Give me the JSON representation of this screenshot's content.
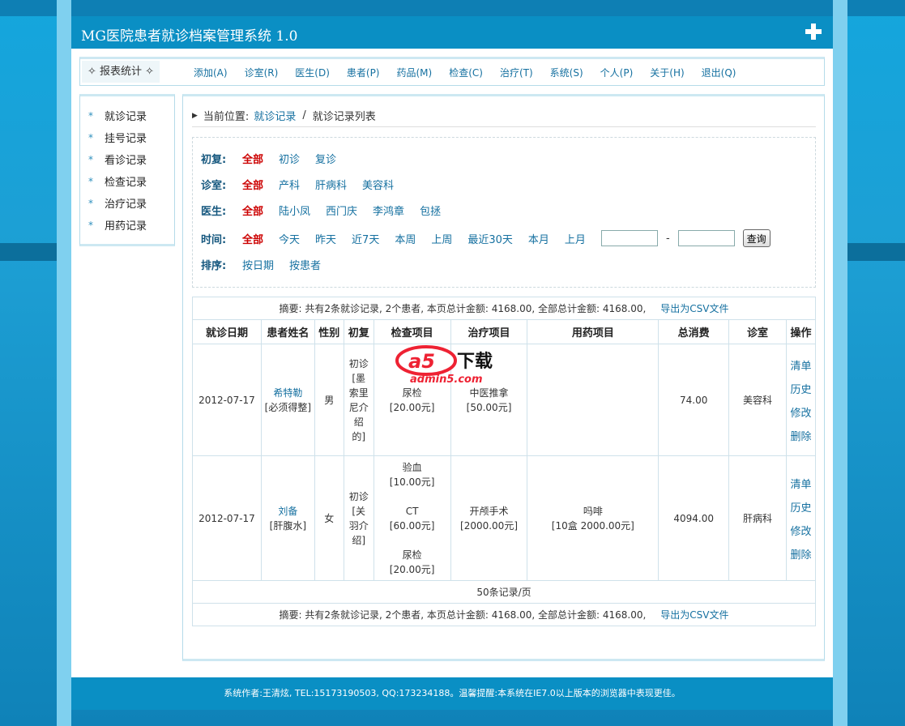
{
  "app": {
    "title": "MG医院患者就诊档案管理系统 1.0"
  },
  "menu": {
    "report_label": "✧ 报表统计 ✧",
    "items": [
      "添加(A)",
      "诊室(R)",
      "医生(D)",
      "患者(P)",
      "药品(M)",
      "检查(C)",
      "治疗(T)",
      "系统(S)",
      "个人(P)",
      "关于(H)",
      "退出(Q)"
    ]
  },
  "sidebar": {
    "items": [
      "就诊记录",
      "挂号记录",
      "看诊记录",
      "检查记录",
      "治疗记录",
      "用药记录"
    ]
  },
  "breadcrumb": {
    "prefix": "当前位置:",
    "link": "就诊记录",
    "sep": "/",
    "current": "就诊记录列表"
  },
  "filters": {
    "visit_type": {
      "label": "初复:",
      "options": [
        "全部",
        "初诊",
        "复诊"
      ]
    },
    "room": {
      "label": "诊室:",
      "options": [
        "全部",
        "产科",
        "肝病科",
        "美容科"
      ]
    },
    "doctor": {
      "label": "医生:",
      "options": [
        "全部",
        "陆小凤",
        "西门庆",
        "李鸿章",
        "包拯"
      ]
    },
    "time": {
      "label": "时间:",
      "options": [
        "全部",
        "今天",
        "昨天",
        "近7天",
        "本周",
        "上周",
        "最近30天",
        "本月",
        "上月"
      ],
      "from_value": "",
      "to_value": "",
      "dash": "-",
      "query_label": "查询"
    },
    "sort": {
      "label": "排序:",
      "options": [
        "按日期",
        "按患者"
      ]
    }
  },
  "summary": {
    "text": "摘要: 共有2条就诊记录, 2个患者, 本页总计金额: 4168.00, 全部总计金额: 4168.00,",
    "export_label": "导出为CSV文件"
  },
  "table": {
    "headers": [
      "就诊日期",
      "患者姓名",
      "性别",
      "初复",
      "检查项目",
      "治疗项目",
      "用药项目",
      "总消费",
      "诊室",
      "操作"
    ],
    "rows": [
      {
        "date": "2012-07-17",
        "patient": "希特勒",
        "patient_note": "[必须得整]",
        "gender": "男",
        "visit": "初诊",
        "visit_note": "[墨索里尼介绍的]",
        "checks": [
          {
            "name": "尿检",
            "price": "[20.00元]"
          }
        ],
        "treatments": [
          {
            "name": "中医推拿",
            "price": "[50.00元]"
          }
        ],
        "drugs": [],
        "total": "74.00",
        "room": "美容科"
      },
      {
        "date": "2012-07-17",
        "patient": "刘备",
        "patient_note": "[肝腹水]",
        "gender": "女",
        "visit": "初诊",
        "visit_note": "[关羽介绍]",
        "checks": [
          {
            "name": "验血",
            "price": "[10.00元]"
          },
          {
            "name": "CT",
            "price": "[60.00元]"
          },
          {
            "name": "尿检",
            "price": "[20.00元]"
          }
        ],
        "treatments": [
          {
            "name": "开颅手术",
            "price": "[2000.00元]"
          }
        ],
        "drugs": [
          {
            "name": "吗啡",
            "detail": "[10盒 2000.00元]"
          }
        ],
        "total": "4094.00",
        "room": "肝病科"
      }
    ],
    "ops": [
      "清单",
      "历史",
      "修改",
      "删除"
    ],
    "pager": "50条记录/页"
  },
  "footer": {
    "text": "系统作者:王清炫, TEL:15173190503, QQ:173234188。温馨提醒:本系统在IE7.0以上版本的浏览器中表现更佳。"
  },
  "watermark": {
    "brand": "a5下载",
    "site": "admin5.com"
  },
  "colors": {
    "header_bg": "#0a8fc4",
    "link": "#1570a0",
    "active": "#cc0000"
  }
}
